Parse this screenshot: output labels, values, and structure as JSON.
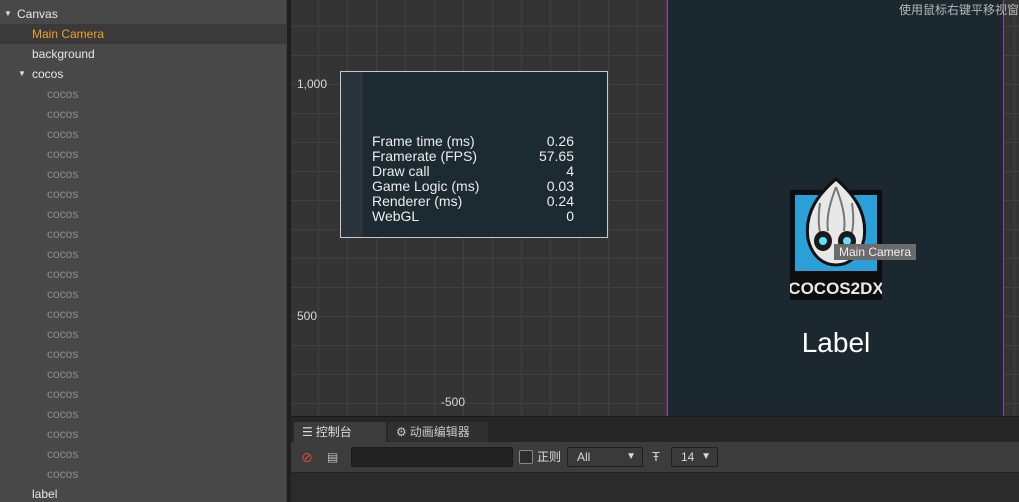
{
  "hierarchy": {
    "items": [
      {
        "label": "Canvas",
        "expanded": true
      },
      {
        "label": "Main Camera",
        "selected": true
      },
      {
        "label": "background"
      },
      {
        "label": "cocos",
        "expanded": true
      },
      {
        "label": "cocos"
      },
      {
        "label": "cocos"
      },
      {
        "label": "cocos"
      },
      {
        "label": "cocos"
      },
      {
        "label": "cocos"
      },
      {
        "label": "cocos"
      },
      {
        "label": "cocos"
      },
      {
        "label": "cocos"
      },
      {
        "label": "cocos"
      },
      {
        "label": "cocos"
      },
      {
        "label": "cocos"
      },
      {
        "label": "cocos"
      },
      {
        "label": "cocos"
      },
      {
        "label": "cocos"
      },
      {
        "label": "cocos"
      },
      {
        "label": "cocos"
      },
      {
        "label": "cocos"
      },
      {
        "label": "cocos"
      },
      {
        "label": "cocos"
      },
      {
        "label": "cocos"
      },
      {
        "label": "label"
      }
    ]
  },
  "scene": {
    "hint": "使用鼠标右键平移视窗",
    "axis_labels": {
      "y_top": "1,000",
      "y_mid": "500",
      "x_left": "-500"
    },
    "stats": [
      {
        "key": "Frame time (ms)",
        "value": "0.26"
      },
      {
        "key": "Framerate (FPS)",
        "value": "57.65"
      },
      {
        "key": "Draw call",
        "value": "4"
      },
      {
        "key": "Game Logic (ms)",
        "value": "0.03"
      },
      {
        "key": "Renderer (ms)",
        "value": "0.24"
      },
      {
        "key": "WebGL",
        "value": "0"
      }
    ],
    "logo_text": "COCOS2DX",
    "camera_tag": "Main Camera",
    "label_node": "Label",
    "colors": {
      "canvas_border": "#9b3ba8",
      "canvas_bg": "#1b2830"
    }
  },
  "console": {
    "tabs": [
      {
        "label": "控制台",
        "icon": "console-icon"
      },
      {
        "label": "动画编辑器",
        "icon": "animation-icon"
      }
    ],
    "search": {
      "value": ""
    },
    "regex_label": "正则",
    "level": "All",
    "font_size": "14",
    "colors": {
      "clear": "#e0463a",
      "selected_node": "#f0a024"
    }
  }
}
